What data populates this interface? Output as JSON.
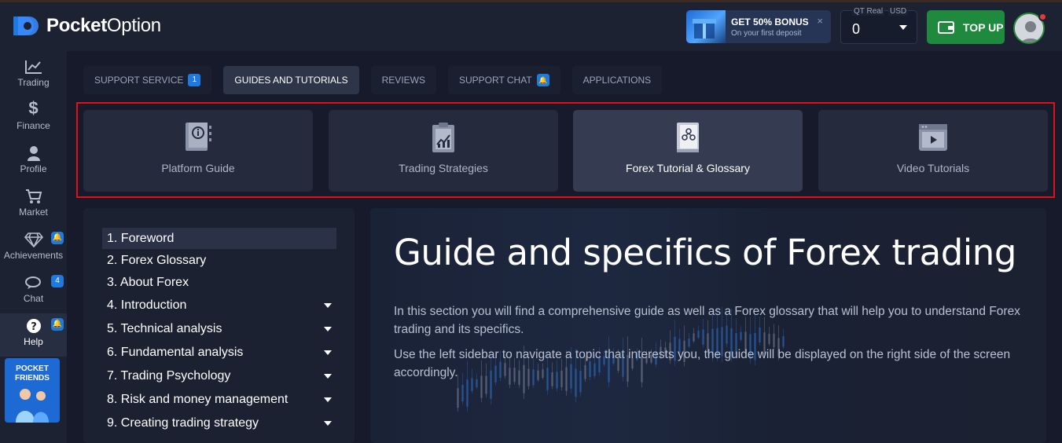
{
  "app": {
    "brand_part1": "Pocket",
    "brand_part2": "Option"
  },
  "header": {
    "bonus": {
      "title": "GET 50% BONUS",
      "subtitle": "On your first deposit",
      "close": "×"
    },
    "account": {
      "type": "QT Real",
      "currency": "USD",
      "balance": "0"
    },
    "topup_label": "TOP UP"
  },
  "sidebar": {
    "items": [
      {
        "label": "Trading",
        "icon": "chart-line-icon"
      },
      {
        "label": "Finance",
        "icon": "dollar-icon"
      },
      {
        "label": "Profile",
        "icon": "user-icon"
      },
      {
        "label": "Market",
        "icon": "cart-icon"
      },
      {
        "label": "Achievements",
        "icon": "diamond-icon",
        "badge": "bell"
      },
      {
        "label": "Chat",
        "icon": "chat-icon",
        "badge": "4"
      },
      {
        "label": "Help",
        "icon": "question-icon",
        "badge": "bell",
        "active": true
      }
    ],
    "promo_title_line1": "POCKET",
    "promo_title_line2": "FRIENDS"
  },
  "tabs": [
    {
      "label": "SUPPORT SERVICE",
      "badge": "1"
    },
    {
      "label": "GUIDES AND TUTORIALS",
      "active": true
    },
    {
      "label": "REVIEWS"
    },
    {
      "label": "SUPPORT CHAT",
      "badge": "bell"
    },
    {
      "label": "APPLICATIONS"
    }
  ],
  "cards": [
    {
      "label": "Platform Guide",
      "icon": "info-book-icon"
    },
    {
      "label": "Trading Strategies",
      "icon": "clipboard-chart-icon"
    },
    {
      "label": "Forex Tutorial & Glossary",
      "icon": "glossary-book-icon",
      "active": true
    },
    {
      "label": "Video Tutorials",
      "icon": "video-player-icon"
    }
  ],
  "toc": [
    {
      "label": "1. Foreword",
      "active": true,
      "expandable": false
    },
    {
      "label": "2. Forex Glossary",
      "expandable": false
    },
    {
      "label": "3. About Forex",
      "expandable": false
    },
    {
      "label": "4. Introduction",
      "expandable": true
    },
    {
      "label": "5. Technical analysis",
      "expandable": true
    },
    {
      "label": "6. Fundamental analysis",
      "expandable": true
    },
    {
      "label": "7. Trading Psychology",
      "expandable": true
    },
    {
      "label": "8. Risk and money management",
      "expandable": true
    },
    {
      "label": "9. Creating trading strategy",
      "expandable": true
    }
  ],
  "content": {
    "title": "Guide and specifics of Forex trading",
    "paragraph1": "In this section you will find a comprehensive guide as well as a Forex glossary that will help you to understand Forex trading and its specifics.",
    "paragraph2": "Use the left sidebar to navigate a topic that interests you, the guide will be displayed on the right side of the screen accordingly."
  },
  "colors": {
    "accent_blue": "#1f7ae0",
    "topup_green": "#1f8a3e",
    "highlight_red": "#e0101a"
  }
}
